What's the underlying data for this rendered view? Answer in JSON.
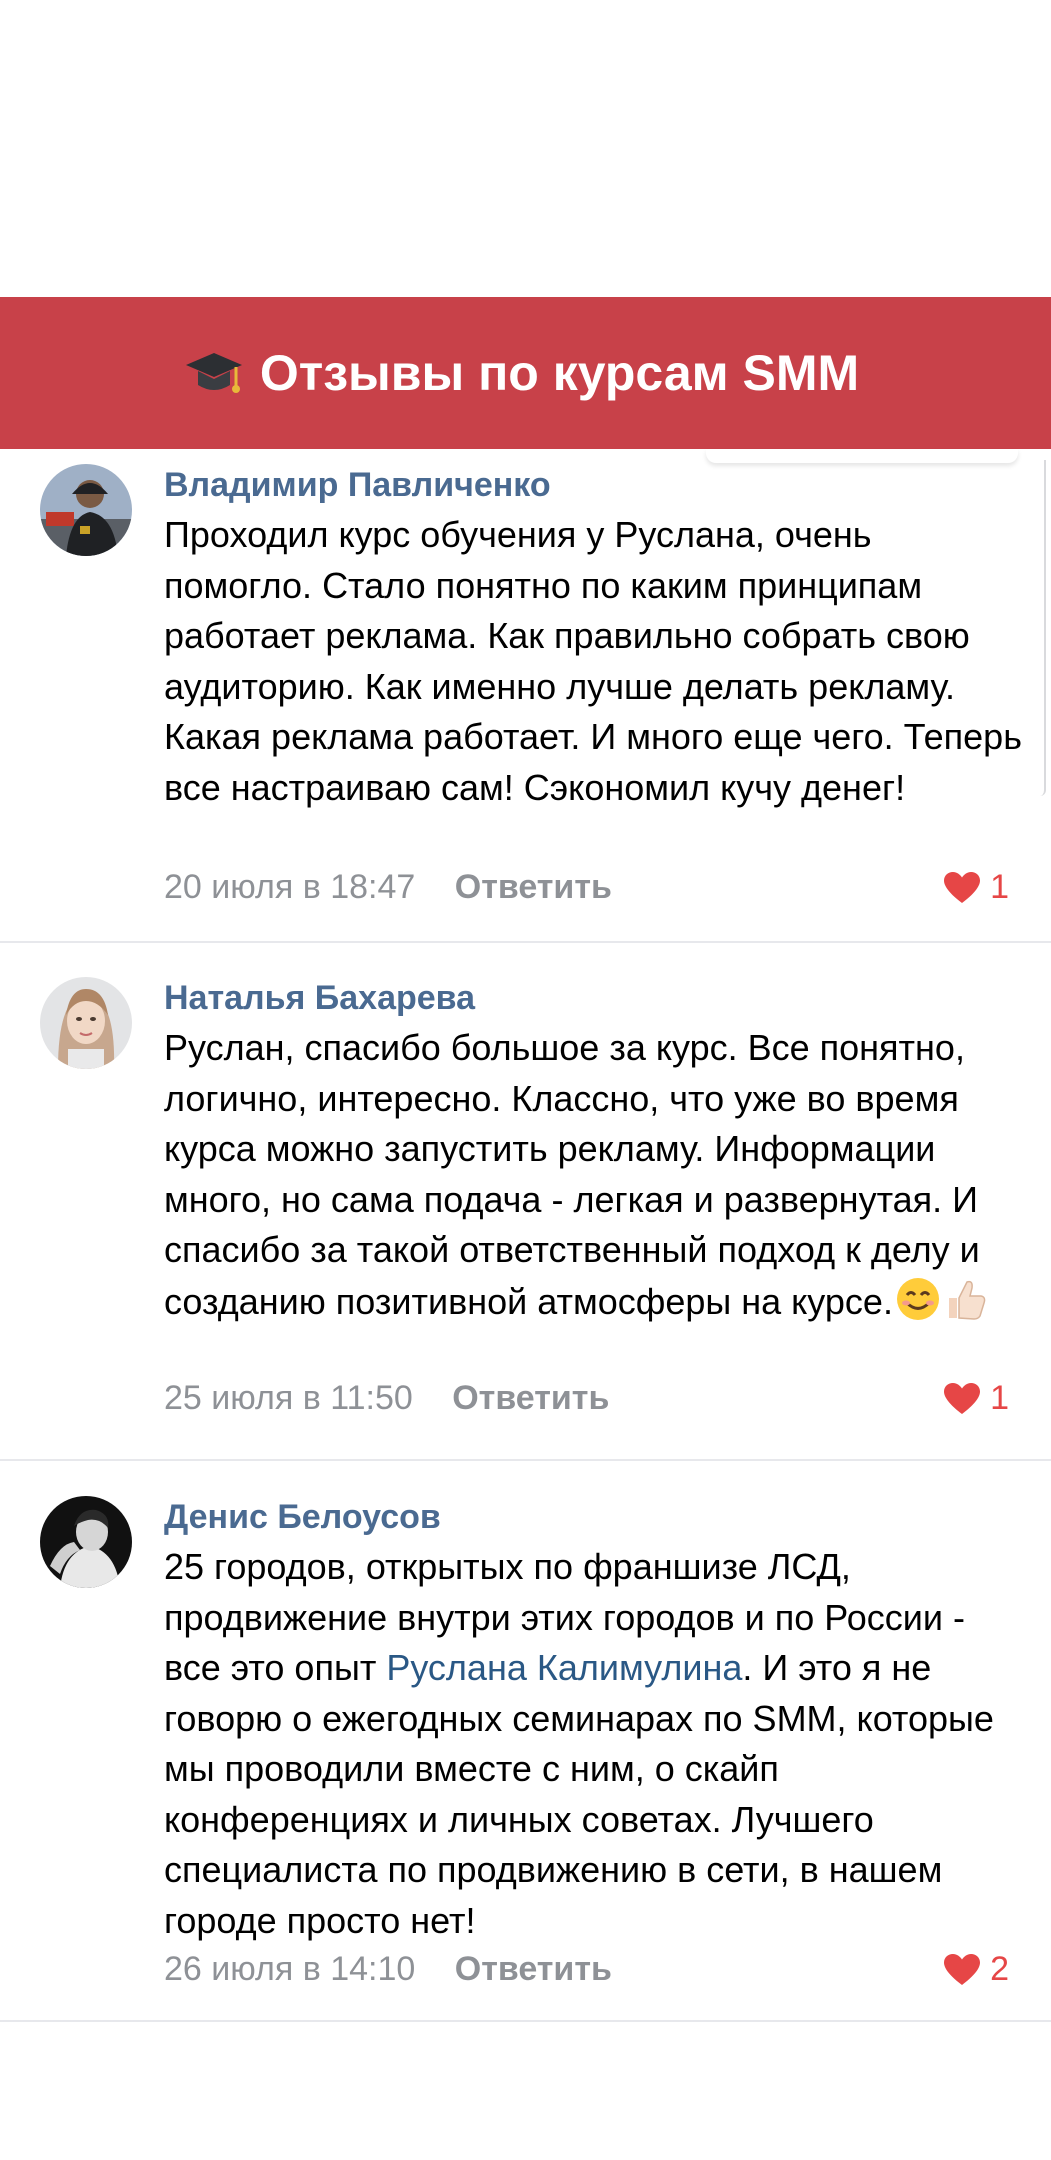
{
  "banner": {
    "icon": "graduation-cap-icon",
    "title": "Отзывы по курсам SMM"
  },
  "colors": {
    "banner_bg": "#c84149",
    "author": "#4a6a91",
    "link": "#2a5885",
    "meta": "#8e9196",
    "like": "#e64646"
  },
  "comments": [
    {
      "author": "Владимир Павличенко",
      "text": "Проходил курс обучения у Руслана, очень помогло. Стало понятно по каким принципам работает реклама. Как правильно собрать свою аудиторию. Как именно лучше делать рекламу. Какая реклама работает. И много еще чего. Теперь все настраиваю сам! Сэкономил кучу денег!",
      "date": "20 июля в 18:47",
      "reply": "Ответить",
      "likes": "1"
    },
    {
      "author": "Наталья Бахарева",
      "text": "Руслан, спасибо большое за курс. Все понятно, логично, интересно. Классно, что уже во время курса можно запустить рекламу. Информации много, но сама подача - легкая и развернутая. И спасибо за такой ответственный подход к делу и созданию позитивной атмосферы на курсе.",
      "emojis": [
        "smiling-face-icon",
        "thumbs-up-icon"
      ],
      "date": "25 июля в 11:50",
      "reply": "Ответить",
      "likes": "1"
    },
    {
      "author": "Денис Белоусов",
      "text_before": "25 городов, открытых по франшизе ЛСД, продвижение внутри этих городов и по России - все это опыт ",
      "mention": "Руслана Калимулина",
      "text_after": ". И это я не говорю о ежегодных семинарах по SMM, которые мы проводили вместе с ним, о скайп конференциях и личных советах. Лучшего специалиста по продвижению в сети, в нашем городе просто нет!",
      "date": "26 июля в 14:10",
      "reply": "Ответить",
      "likes": "2"
    }
  ]
}
